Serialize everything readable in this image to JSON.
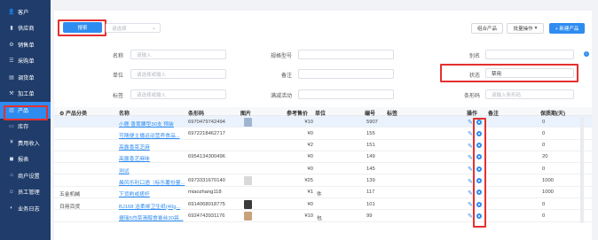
{
  "sidebar": {
    "items": [
      {
        "label": "客户",
        "icon": "user-icon"
      },
      {
        "label": "供应商",
        "icon": "supplier-icon"
      },
      {
        "label": "销售单",
        "icon": "sales-icon"
      },
      {
        "label": "采购单",
        "icon": "purchase-icon"
      },
      {
        "label": "调货单",
        "icon": "transfer-icon"
      },
      {
        "label": "加工单",
        "icon": "process-icon"
      },
      {
        "label": "产品",
        "icon": "product-icon"
      },
      {
        "label": "库存",
        "icon": "inventory-icon"
      },
      {
        "label": "费用收入",
        "icon": "finance-icon"
      },
      {
        "label": "报表",
        "icon": "report-icon"
      },
      {
        "label": "商户设置",
        "icon": "settings-icon"
      },
      {
        "label": "员工管理",
        "icon": "staff-icon"
      },
      {
        "label": "业务日志",
        "icon": "log-icon"
      }
    ],
    "active_index": 6
  },
  "toolbar": {
    "search_label": "搜索",
    "select_placeholder": "请选择",
    "combo_label": "组合产品",
    "batch_label": "批量操作",
    "new_label": "+ 新建产品"
  },
  "filters": {
    "name": {
      "label": "名称",
      "placeholder": "请输入"
    },
    "model": {
      "label": "规格型号",
      "placeholder": ""
    },
    "alias": {
      "label": "别名",
      "placeholder": ""
    },
    "unit": {
      "label": "单位",
      "placeholder": "请选择或输入"
    },
    "remark": {
      "label": "备注",
      "placeholder": ""
    },
    "status": {
      "label": "状态",
      "value": "禁用"
    },
    "tag": {
      "label": "标签",
      "placeholder": "请选择或输入"
    },
    "promo": {
      "label": "满减活动",
      "placeholder": ""
    },
    "barcode": {
      "label": "条形码",
      "placeholder": "请输入条形码"
    }
  },
  "table": {
    "headers": {
      "category": "⚙ 产品分类",
      "name": "名称",
      "barcode": "条形码",
      "image": "图片",
      "price": "参考售价",
      "unit": "单位",
      "code": "编号",
      "tag": "标签",
      "action": "操作",
      "remark": "备注",
      "shelf": "保质期(天)"
    },
    "rows": [
      {
        "category": "",
        "name": "小鹿 香蕉腰型30支 预装",
        "barcode": "6970479742494",
        "price": "¥10",
        "unit": "",
        "code": "5907",
        "shelf": "0",
        "thumb": "#9fb4cf"
      },
      {
        "category": "",
        "name": "可随便主播运动营养食品...",
        "barcode": "6972218462717",
        "price": "¥0",
        "unit": "",
        "code": "155",
        "shelf": "0",
        "thumb": ""
      },
      {
        "category": "",
        "name": "高露香菜芝麻",
        "barcode": "",
        "price": "¥2",
        "unit": "",
        "code": "151",
        "shelf": "0",
        "thumb": ""
      },
      {
        "category": "",
        "name": "高露香芝麻味",
        "barcode": "6954134300496",
        "price": "¥0",
        "unit": "",
        "code": "149",
        "shelf": "20",
        "thumb": ""
      },
      {
        "category": "",
        "name": "测试",
        "barcode": "",
        "price": "¥0",
        "unit": "",
        "code": "145",
        "shelf": "0",
        "thumb": ""
      },
      {
        "category": "",
        "name": "晨风乐利口酒（标乐薯份量...",
        "barcode": "6973331670140",
        "price": "¥25",
        "unit": "",
        "code": "139",
        "shelf": "1000",
        "thumb": "#d9d9d9"
      },
      {
        "category": "五金机械",
        "name": "下货刷或搓杆",
        "barcode": "miaozhang118",
        "price": "¥1",
        "unit": "件",
        "code": "117",
        "shelf": "1000",
        "thumb": ""
      },
      {
        "category": "日用百货",
        "name": "BJ168 洁柔绑卫生纸(40g...",
        "barcode": "6914068018775",
        "price": "¥0",
        "unit": "",
        "code": "101",
        "shelf": "0",
        "thumb": "#3a3a3a"
      },
      {
        "category": "",
        "name": "捷瑞5白菜清醇食膏丝30袋...",
        "barcode": "6924743931176",
        "price": "¥10",
        "unit": "包",
        "code": "99",
        "shelf": "0",
        "thumb": "#c8a27a"
      }
    ]
  }
}
